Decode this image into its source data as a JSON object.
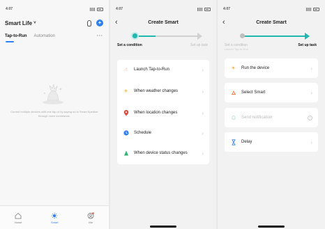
{
  "panel1": {
    "time": "4:07",
    "title": "Smart Life",
    "title_caret": "˅",
    "tabs": [
      "Tap-to-Run",
      "Automation"
    ],
    "more": "···",
    "empty_text": "Control multiple devices with one tap or by saying so to Smart Speaker through voice commands.",
    "tabbar": [
      {
        "label": "Home",
        "icon": "home-icon"
      },
      {
        "label": "Smart",
        "icon": "smart-icon"
      },
      {
        "label": "Me",
        "icon": "me-icon"
      }
    ],
    "accent": "#2d7ff9"
  },
  "panel2": {
    "time": "4:07",
    "back": "‹",
    "title": "Create Smart",
    "steps": [
      "Set a condition",
      "Set up task"
    ],
    "active_step": 0,
    "items": [
      {
        "label": "Launch Tap-to-Run",
        "icon": "hand-tap-icon",
        "color": "#f07b3f"
      },
      {
        "label": "When weather changes",
        "icon": "sun-icon",
        "color": "#f5a623"
      },
      {
        "label": "When location changes",
        "icon": "location-pin-icon",
        "color": "#e8453c"
      },
      {
        "label": "Schedule",
        "icon": "clock-icon",
        "color": "#2d7ff9"
      },
      {
        "label": "When device status changes",
        "icon": "device-icon",
        "color": "#2bb673"
      }
    ],
    "chevron": "›",
    "accent": "#1fb8b0"
  },
  "panel3": {
    "time": "4:07",
    "back": "‹",
    "title": "Create Smart",
    "steps": [
      "Set a condition",
      "Set up task"
    ],
    "step_sub": "Launch Tap-to-Run",
    "active_step": 1,
    "items": [
      {
        "label": "Run the device",
        "icon": "device-run-icon",
        "color": "#f5a623",
        "enabled": true
      },
      {
        "label": "Select Smart",
        "icon": "smart-select-icon",
        "color": "#f07b3f",
        "enabled": true
      },
      {
        "label": "Send notification",
        "icon": "bell-icon",
        "color": "#b5dcd9",
        "enabled": false
      },
      {
        "label": "Delay",
        "icon": "hourglass-icon",
        "color": "#2d7ff9",
        "enabled": true
      }
    ],
    "chevron": "›",
    "accent": "#1fb8b0"
  }
}
